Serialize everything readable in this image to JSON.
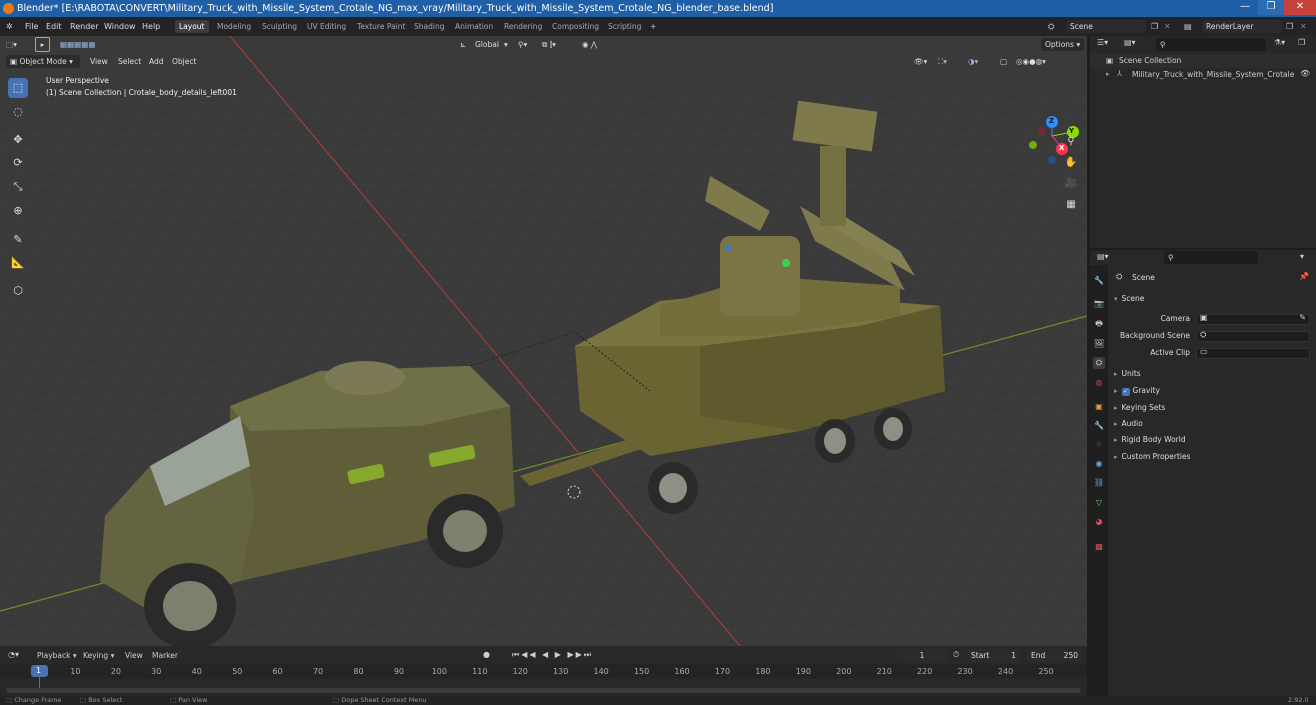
{
  "window": {
    "title": "Blender* [E:\\RABOTA\\CONVERT\\Military_Truck_with_Missile_System_Crotale_NG_max_vray/Military_Truck_with_Missile_System_Crotale_NG_blender_base.blend]",
    "minimize": "—",
    "maximize": "❐",
    "close": "✕"
  },
  "menu": [
    "File",
    "Edit",
    "Render",
    "Window",
    "Help"
  ],
  "workspaces": [
    "Layout",
    "Modeling",
    "Sculpting",
    "UV Editing",
    "Texture Paint",
    "Shading",
    "Animation",
    "Rendering",
    "Compositing",
    "Scripting",
    "+"
  ],
  "active_workspace": "Layout",
  "scene_field": "Scene",
  "renderlayer_field": "RenderLayer",
  "viewport": {
    "mode": "Object Mode",
    "menus": [
      "View",
      "Select",
      "Add",
      "Object"
    ],
    "transform_orientation": "Global",
    "options": "Options",
    "overlay_line1": "User Perspective",
    "overlay_line2": "(1) Scene Collection | Crotale_body_details_left001",
    "gizmo_axes": {
      "x": "X",
      "y": "Y",
      "z": "Z"
    }
  },
  "outliner": {
    "root": "Scene Collection",
    "items": [
      "Military_Truck_with_Missile_System_Crotale"
    ]
  },
  "properties": {
    "header": "Scene",
    "section": "Scene",
    "fields": [
      {
        "label": "Camera"
      },
      {
        "label": "Background Scene"
      },
      {
        "label": "Active Clip"
      }
    ],
    "panels": [
      "Units",
      "Gravity",
      "Keying Sets",
      "Audio",
      "Rigid Body World",
      "Custom Properties"
    ],
    "gravity_checked": true
  },
  "timeline": {
    "menus": [
      "Playback",
      "Keying",
      "View",
      "Marker"
    ],
    "current_frame": "1",
    "start_label": "Start",
    "start_value": "1",
    "end_label": "End",
    "end_value": "250",
    "ticks": [
      "1",
      "10",
      "20",
      "30",
      "40",
      "50",
      "60",
      "70",
      "80",
      "90",
      "100",
      "110",
      "120",
      "130",
      "140",
      "150",
      "160",
      "170",
      "180",
      "190",
      "200",
      "210",
      "220",
      "230",
      "240",
      "250"
    ]
  },
  "statusbar": {
    "items": [
      "Change Frame",
      "Box Select",
      "Pan View",
      "Dope Sheet Context Menu"
    ],
    "version": "2.92.0"
  },
  "colors": {
    "accent": "#4772b3",
    "titlebar": "#1f5fa8",
    "axis_x": "#ff3352",
    "axis_y": "#8bdc00",
    "axis_z": "#2890ff",
    "model": "#6b6a3a"
  }
}
